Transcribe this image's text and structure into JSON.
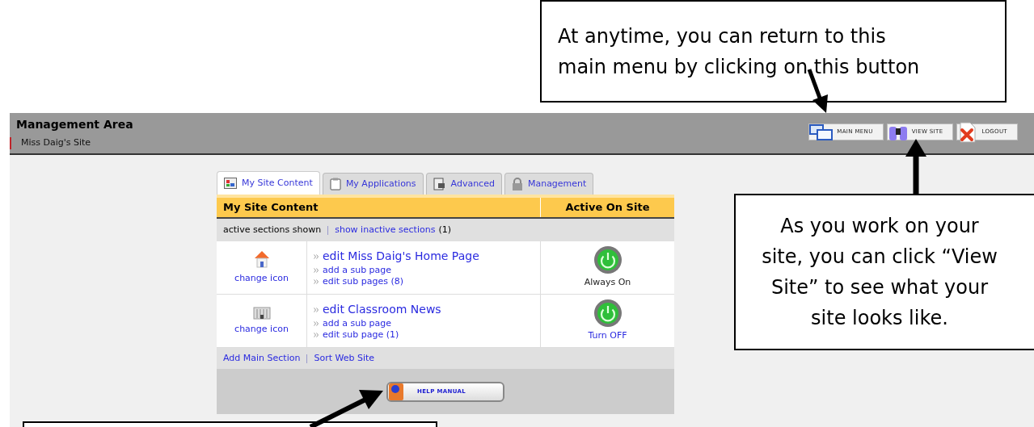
{
  "header": {
    "title": "Management Area",
    "site": "Miss Daig's Site",
    "buttons": [
      {
        "label": "MAIN MENU",
        "kind": "windows"
      },
      {
        "label": "VIEW SITE",
        "kind": "binoculars"
      },
      {
        "label": "LOGOUT",
        "kind": "logout"
      }
    ]
  },
  "tabs": [
    {
      "label": "My Site Content",
      "selected": true,
      "kind": "content"
    },
    {
      "label": "My Applications",
      "selected": false,
      "kind": "clipboard"
    },
    {
      "label": "Advanced",
      "selected": false,
      "kind": "advanced"
    },
    {
      "label": "Management",
      "selected": false,
      "kind": "lock"
    }
  ],
  "table": {
    "columns": [
      "My Site Content",
      "Active On Site"
    ],
    "filter": {
      "current": "active sections shown",
      "link": "show inactive sections",
      "count": "(1)"
    },
    "rows": [
      {
        "kind": "house",
        "icon_link": "change icon",
        "title": "edit Miss Daig's Home Page",
        "links": [
          "add a sub page",
          "edit sub pages (8)"
        ],
        "status": {
          "text": "Always On",
          "kind": "label"
        }
      },
      {
        "kind": "building",
        "icon_link": "change icon",
        "title": "edit Classroom News",
        "links": [
          "add a sub page",
          "edit sub page (1)"
        ],
        "status": {
          "text": "Turn OFF",
          "kind": "link"
        }
      }
    ],
    "footer_links": [
      "Add Main Section",
      "Sort Web Site"
    ]
  },
  "help_button": "HELP MANUAL",
  "callouts": [
    {
      "text": "At anytime, you can return to this main menu by clicking on this button",
      "kind": "top"
    },
    {
      "text": "As you work on your site, you can click “View Site” to see what your site looks like.",
      "kind": "right"
    },
    {
      "kind": "bottom"
    }
  ]
}
